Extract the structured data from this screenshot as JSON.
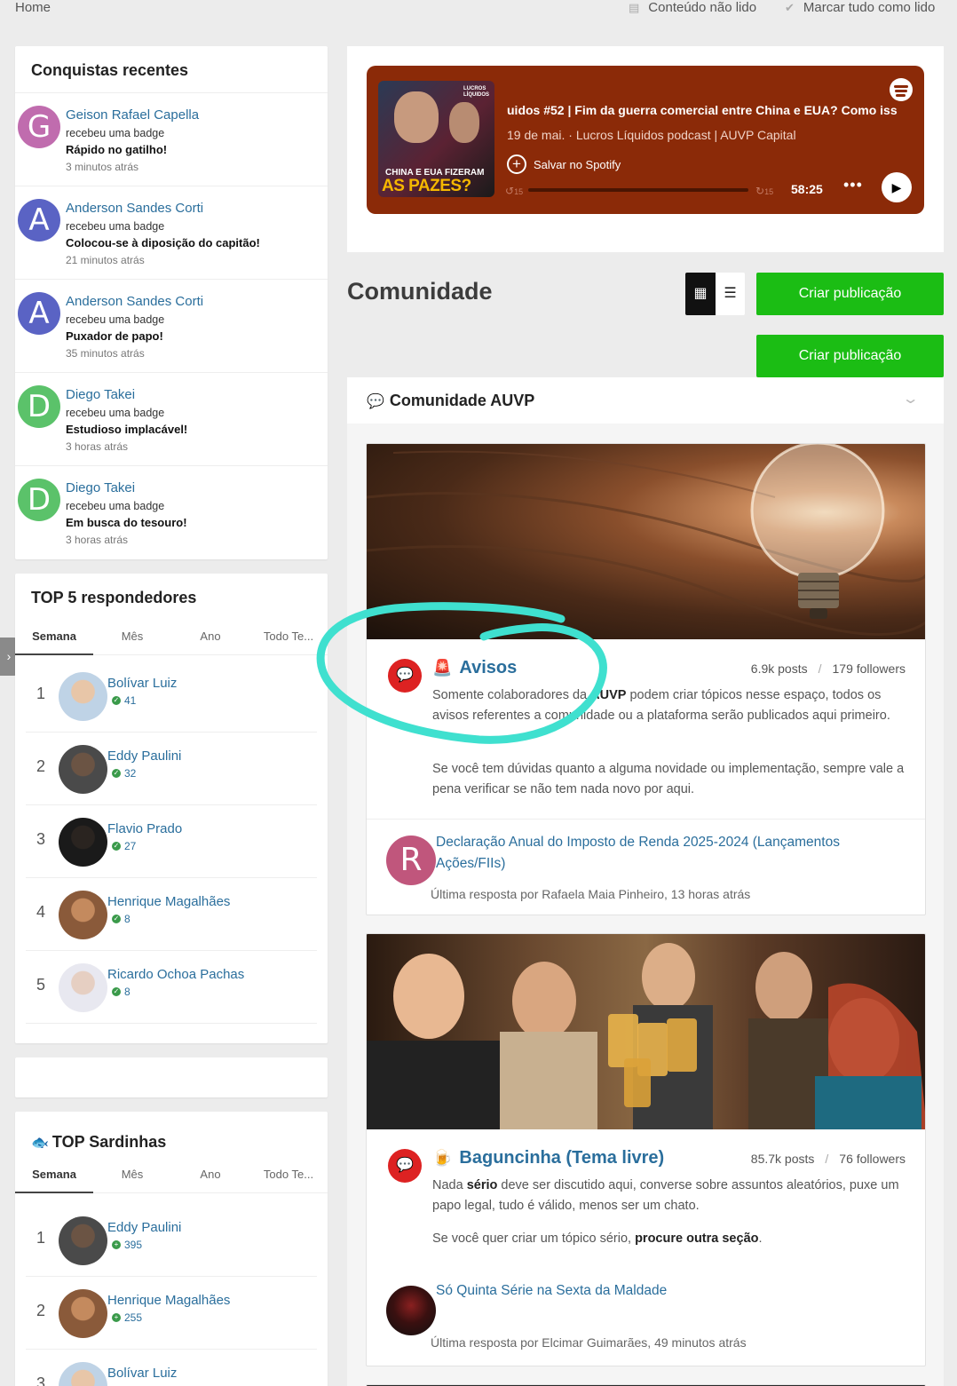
{
  "topbar": {
    "home": "Home",
    "unread_label": "Conteúdo não lido",
    "mark_read_label": "Marcar tudo como lido"
  },
  "achievements": {
    "title": "Conquistas recentes",
    "items": [
      {
        "initial": "G",
        "color": "#c06cae",
        "name": "Geison Rafael Capella",
        "action": "recebeu uma badge",
        "badge": "Rápido no gatilho!",
        "time": "3 minutos atrás"
      },
      {
        "initial": "A",
        "color": "#5a63c4",
        "name": "Anderson Sandes Corti",
        "action": "recebeu uma badge",
        "badge": "Colocou-se à diposição do capitão!",
        "time": "21 minutos atrás"
      },
      {
        "initial": "A",
        "color": "#5a63c4",
        "name": "Anderson Sandes Corti",
        "action": "recebeu uma badge",
        "badge": "Puxador de papo!",
        "time": "35 minutos atrás"
      },
      {
        "initial": "D",
        "color": "#5bc26a",
        "name": "Diego Takei",
        "action": "recebeu uma badge",
        "badge": "Estudioso implacável!",
        "time": "3 horas atrás"
      },
      {
        "initial": "D",
        "color": "#5bc26a",
        "name": "Diego Takei",
        "action": "recebeu uma badge",
        "badge": "Em busca do tesouro!",
        "time": "3 horas atrás"
      }
    ]
  },
  "top_responders": {
    "title": "TOP 5 respondedores",
    "tabs": [
      "Semana",
      "Mês",
      "Ano",
      "Todo Te..."
    ],
    "rows": [
      {
        "rank": "1",
        "name": "Bolívar Luiz",
        "score": "41"
      },
      {
        "rank": "2",
        "name": "Eddy Paulini",
        "score": "32"
      },
      {
        "rank": "3",
        "name": "Flavio Prado",
        "score": "27"
      },
      {
        "rank": "4",
        "name": "Henrique Magalhães",
        "score": "8"
      },
      {
        "rank": "5",
        "name": "Ricardo Ochoa Pachas",
        "score": "8"
      }
    ]
  },
  "top_sardinhas": {
    "title": "TOP Sardinhas",
    "tabs": [
      "Semana",
      "Mês",
      "Ano",
      "Todo Te..."
    ],
    "rows": [
      {
        "rank": "1",
        "name": "Eddy Paulini",
        "score": "395"
      },
      {
        "rank": "2",
        "name": "Henrique Magalhães",
        "score": "255"
      },
      {
        "rank": "3",
        "name": "Bolívar Luiz",
        "score": ""
      }
    ]
  },
  "spotify": {
    "title": "uidos #52 | Fim da guerra comercial entre China e EUA? Como iss",
    "subtitle": "19 de mai. · Lucros Líquidos podcast | AUVP Capital",
    "save_label": "Salvar no Spotify",
    "duration": "58:25",
    "cover_brand": "LUCROS LÍQUIDOS",
    "cover_line1": "CHINA E EUA FIZERAM",
    "cover_line2": "AS PAZES?",
    "skip_back": "15",
    "skip_fwd": "15"
  },
  "community": {
    "heading": "Comunidade",
    "create_label": "Criar publicação",
    "section_title": "Comunidade AUVP"
  },
  "forums": [
    {
      "title": "Avisos",
      "emoji": "🚨",
      "posts": "6.9k posts",
      "followers": "179 followers",
      "desc1_a": "Somente colaboradores da ",
      "desc1_b": "AUVP",
      "desc1_c": " podem criar tópicos nesse espaço, todos os avisos referentes a comunidade ou a plataforma serão publicados aqui primeiro.",
      "desc2": "Se você tem dúvidas quanto a alguma novidade ou implementação, sempre vale a pena verificar se não tem nada novo por aqui.",
      "last_initial": "R",
      "last_title": "Declaração Anual do Imposto de Renda 2025-2024 (Lançamentos Ações/FIIs)",
      "last_meta": "Última resposta por Rafaela Maia Pinheiro, 13 horas atrás"
    },
    {
      "title": "Baguncinha (Tema livre)",
      "emoji": "🍺",
      "posts": "85.7k posts",
      "followers": "76 followers",
      "desc1_a": "Nada ",
      "desc1_b": "sério",
      "desc1_c": " deve ser discutido aqui, converse sobre assuntos aleatórios, puxe um papo legal, tudo é válido, menos ser um chato.",
      "desc2_a": "Se você quer criar um tópico sério, ",
      "desc2_b": "procure outra seção",
      "desc2_c": ".",
      "last_title": "Só Quinta Série na Sexta da Maldade",
      "last_meta": "Última resposta por Elcimar Guimarães, 49 minutos atrás"
    }
  ],
  "colors": {
    "link": "#2a6e9c",
    "green_button": "#1bbd14",
    "spotify_bg": "#8b2a08",
    "forum_icon": "#dd2222",
    "annotation": "#3fe0cf"
  }
}
